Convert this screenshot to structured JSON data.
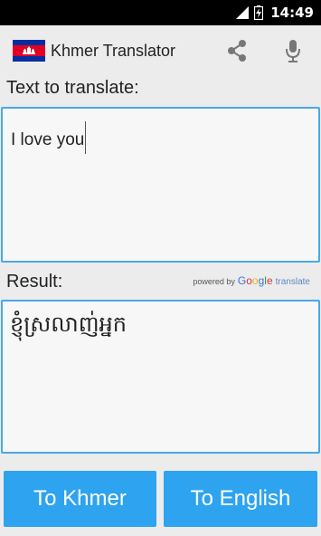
{
  "status_bar": {
    "time": "14:49"
  },
  "action_bar": {
    "title": "Khmer Translator",
    "flag_icon": "cambodia-flag-icon",
    "share_icon": "share-icon",
    "mic_icon": "microphone-icon"
  },
  "input": {
    "label": "Text to translate:",
    "value": "I love you"
  },
  "result": {
    "label": "Result:",
    "value": "ខ្ញុំស្រលាញ់អ្នក"
  },
  "attribution": {
    "powered_by": "powered by",
    "google_letters": [
      "G",
      "o",
      "o",
      "g",
      "l",
      "e"
    ],
    "translate": "translate"
  },
  "buttons": {
    "to_khmer": "To Khmer",
    "to_english": "To English"
  },
  "colors": {
    "accent": "#2ea3ef",
    "box_border": "#4aa8e8",
    "google": [
      "#3b73d6",
      "#d9392f",
      "#f2b418",
      "#3b73d6",
      "#2a9b45",
      "#d9392f"
    ]
  }
}
